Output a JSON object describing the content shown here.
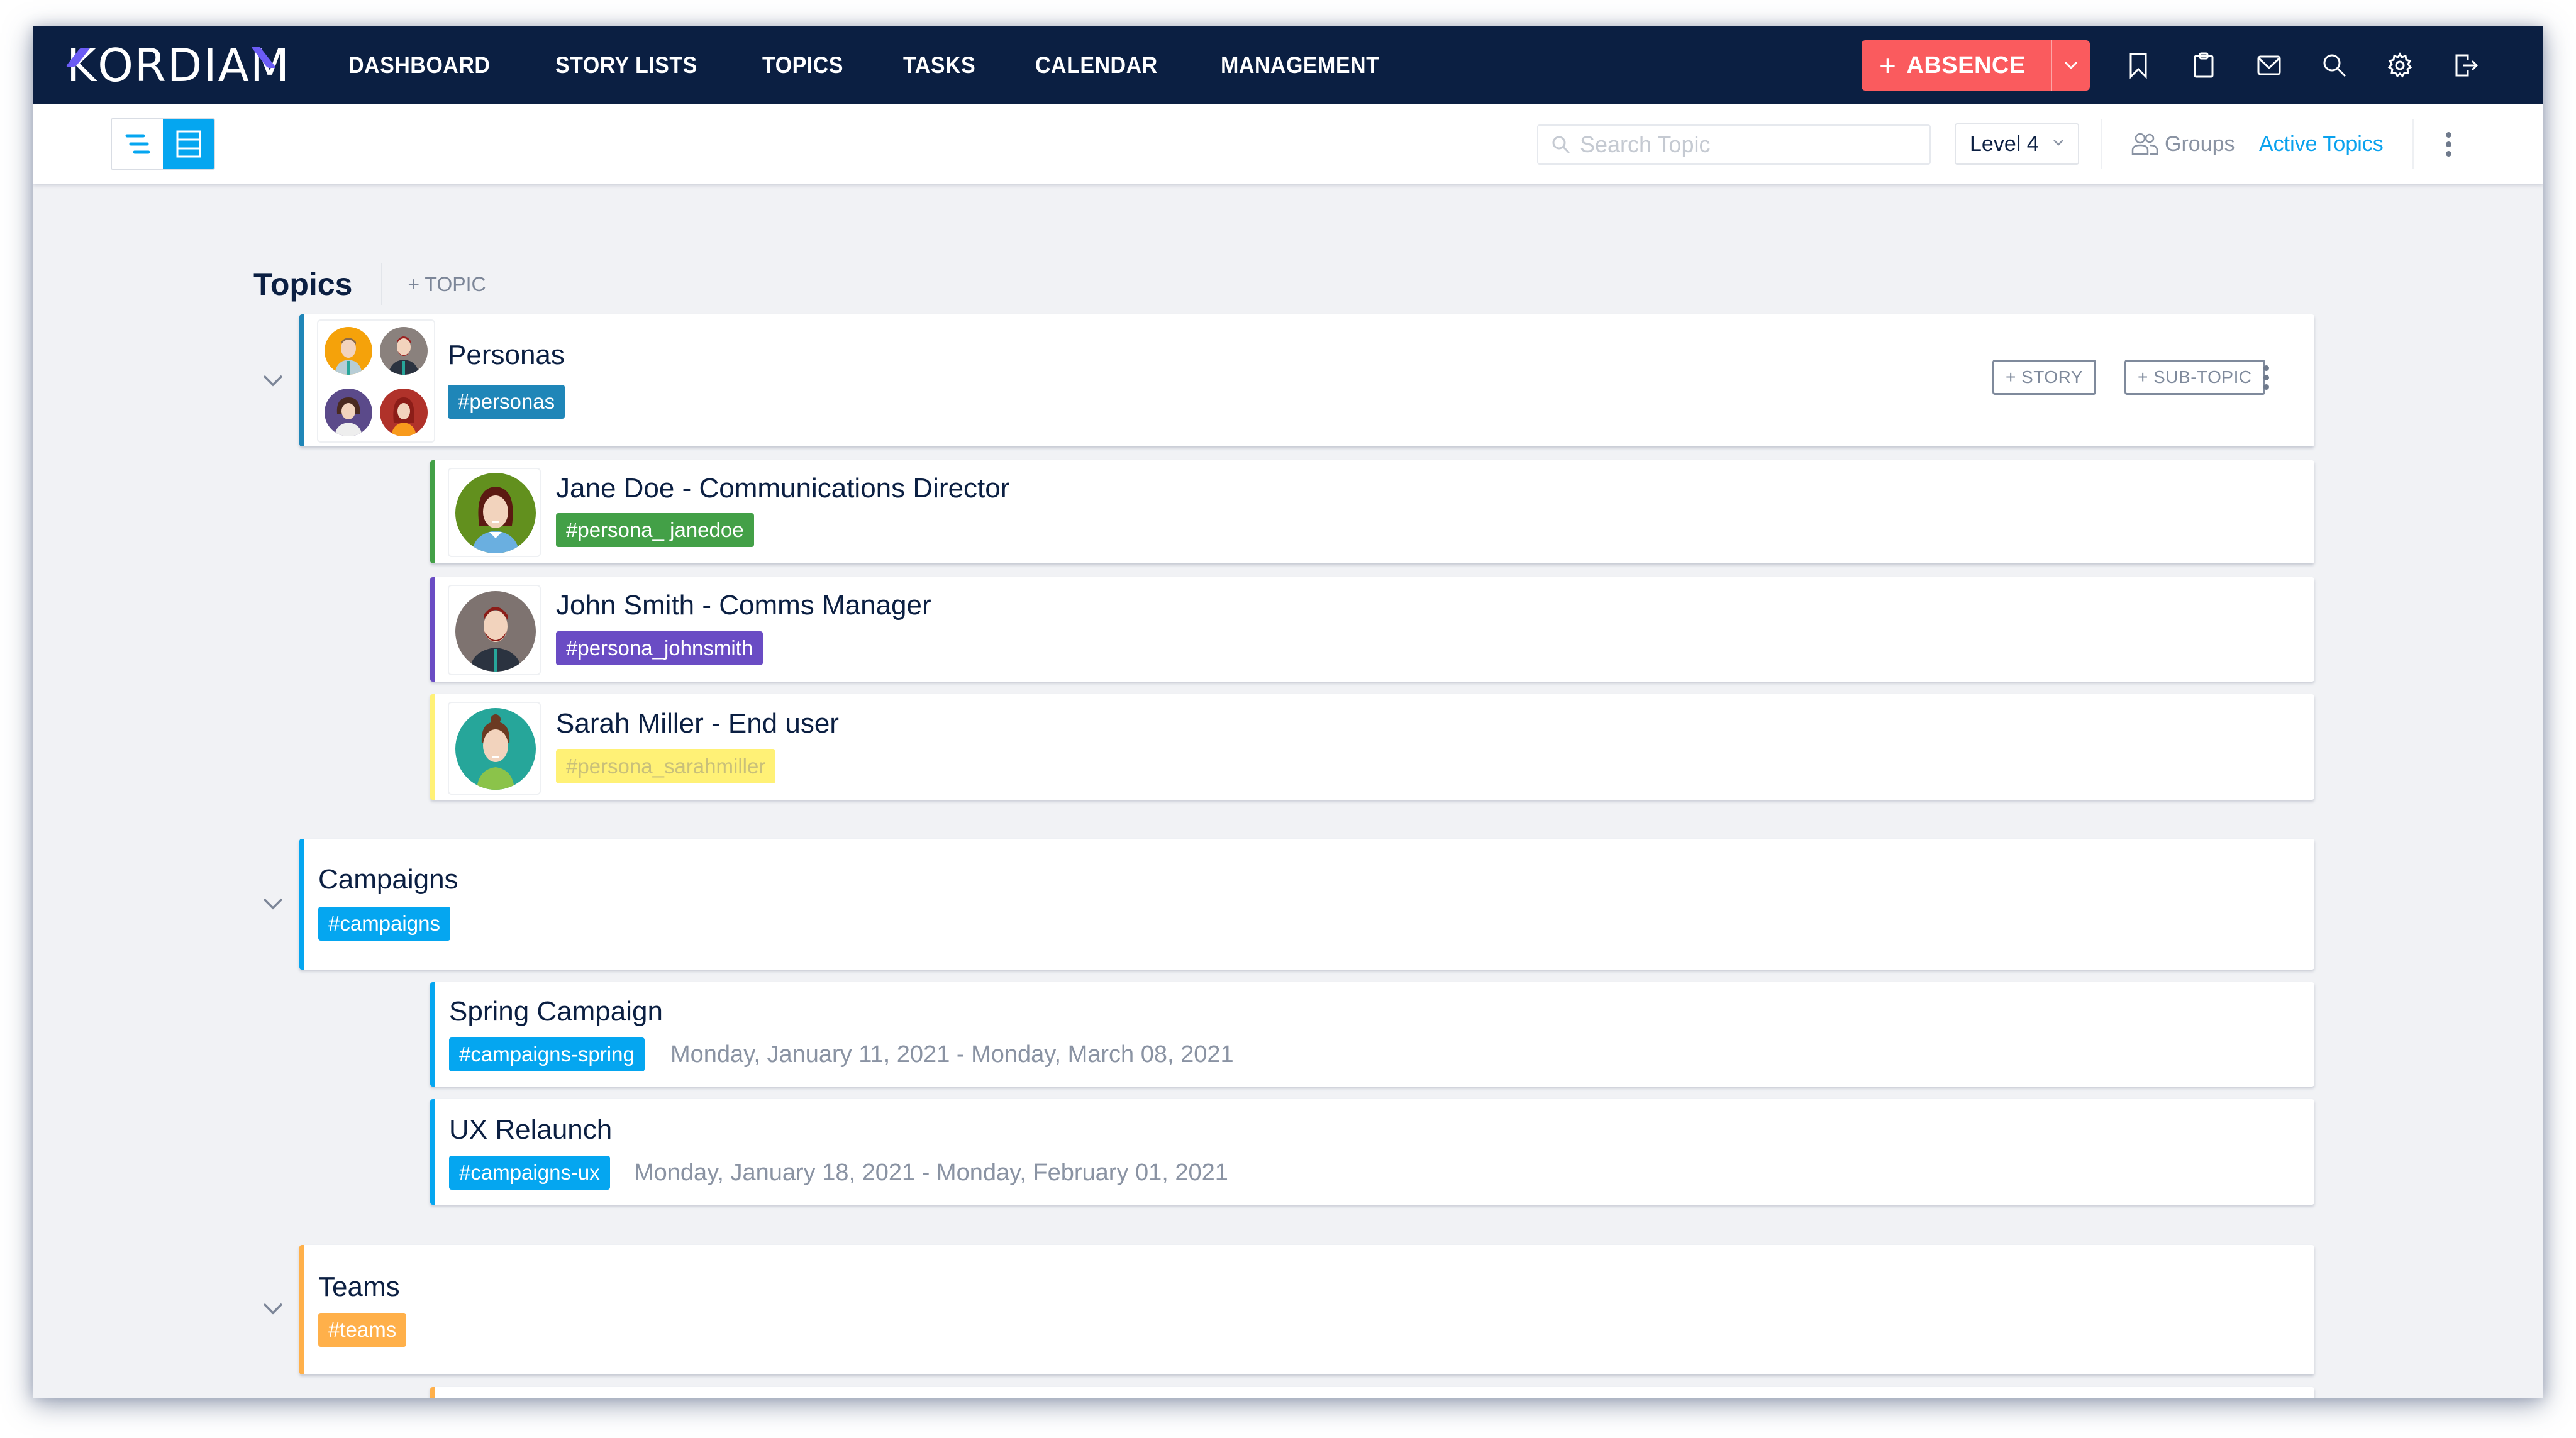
{
  "app": {
    "logo": "KORDIAM"
  },
  "nav": {
    "links": [
      "DASHBOARD",
      "STORY LISTS",
      "TOPICS",
      "TASKS",
      "CALENDAR",
      "MANAGEMENT"
    ],
    "absence_button": "ABSENCE",
    "absence_plus": "+",
    "icons": [
      "bookmark-icon",
      "clipboard-icon",
      "mail-icon",
      "search-icon",
      "gear-icon",
      "logout-icon"
    ]
  },
  "toolbar": {
    "view_modes": [
      "tree-view",
      "list-view"
    ],
    "active_view": "list-view",
    "search_placeholder": "Search Topic",
    "search_value": "",
    "level_select": "Level 4",
    "groups_label": "Groups",
    "active_topics_label": "Active Topics"
  },
  "page": {
    "title": "Topics",
    "add_topic": "+ TOPIC"
  },
  "colors": {
    "navbar": "#0b1f42",
    "accent_blue": "#05a6f0",
    "absence_red": "#fa5b5e",
    "logo_accent": "#6b5cf5"
  },
  "topics": [
    {
      "title": "Personas",
      "tag": "#personas",
      "color": "#1f86b8",
      "actions": {
        "story": "+ STORY",
        "subtopic": "+ SUB-TOPIC"
      },
      "children": [
        {
          "title": "Jane Doe - Communications Director",
          "tag": "#persona_ janedoe",
          "color": "#43a047",
          "text_color": "#ffffff",
          "avatar": "woman-green"
        },
        {
          "title": "John Smith - Comms Manager",
          "tag": "#persona_johnsmith",
          "color": "#6a4cc4",
          "text_color": "#ffffff",
          "avatar": "man-beard-gray"
        },
        {
          "title": "Sarah Miller - End user",
          "tag": "#persona_sarahmiller",
          "color": "#fff176",
          "text_color": "#c9c07a",
          "avatar": "woman-teal"
        }
      ]
    },
    {
      "title": "Campaigns",
      "tag": "#campaigns",
      "color": "#05a6f0",
      "children": [
        {
          "title": "Spring Campaign",
          "tag": "#campaigns-spring",
          "color": "#05a6f0",
          "text_color": "#ffffff",
          "dates": "Monday, January 11, 2021 - Monday, March 08, 2021"
        },
        {
          "title": "UX Relaunch",
          "tag": "#campaigns-ux",
          "color": "#05a6f0",
          "text_color": "#ffffff",
          "dates": "Monday, January 18, 2021 - Monday, February 01, 2021"
        }
      ]
    },
    {
      "title": "Teams",
      "tag": "#teams",
      "color": "#ffb04a",
      "children": []
    }
  ]
}
